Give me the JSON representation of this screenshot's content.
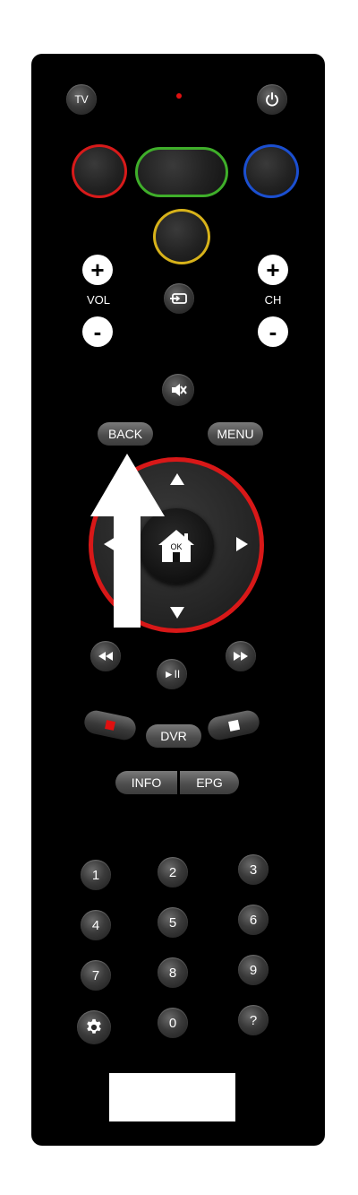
{
  "remote": {
    "tv_label": "TV",
    "power_icon": "power-icon",
    "led_color": "#e01010",
    "color_buttons": {
      "red": "#d71a1a",
      "green": "#3fae2a",
      "blue": "#1b4fd0",
      "yellow": "#d7b21a"
    },
    "vol_label": "VOL",
    "ch_label": "CH",
    "plus": "+",
    "minus": "-",
    "back_label": "BACK",
    "menu_label": "MENU",
    "ok_label": "OK",
    "dpad_ring_color": "#d81818",
    "dvr_label": "DVR",
    "info_label": "INFO",
    "epg_label": "EPG",
    "play_pause_label": "►II",
    "keypad": [
      "1",
      "2",
      "3",
      "4",
      "5",
      "6",
      "7",
      "8",
      "9",
      "0",
      "?"
    ],
    "settings_icon": "gear-icon"
  }
}
